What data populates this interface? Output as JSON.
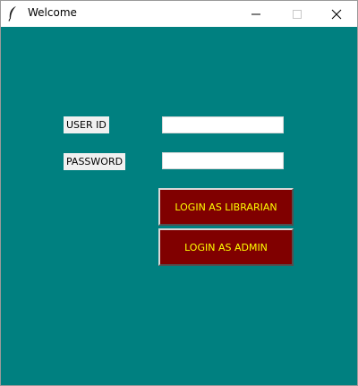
{
  "window": {
    "title": "Welcome",
    "icon": "feather-icon",
    "controls": [
      "minimize-icon",
      "maximize-icon",
      "close-icon"
    ]
  },
  "form": {
    "user_id_label": "USER ID",
    "password_label": "PASSWORD",
    "user_id_value": "",
    "password_value": ""
  },
  "buttons": {
    "librarian": "LOGIN AS LIBRARIAN",
    "admin": "LOGIN AS ADMIN"
  },
  "colors": {
    "background": "#008080",
    "button_bg": "#800000",
    "button_text": "#ffff00",
    "label_bg": "#f0f0f0"
  }
}
